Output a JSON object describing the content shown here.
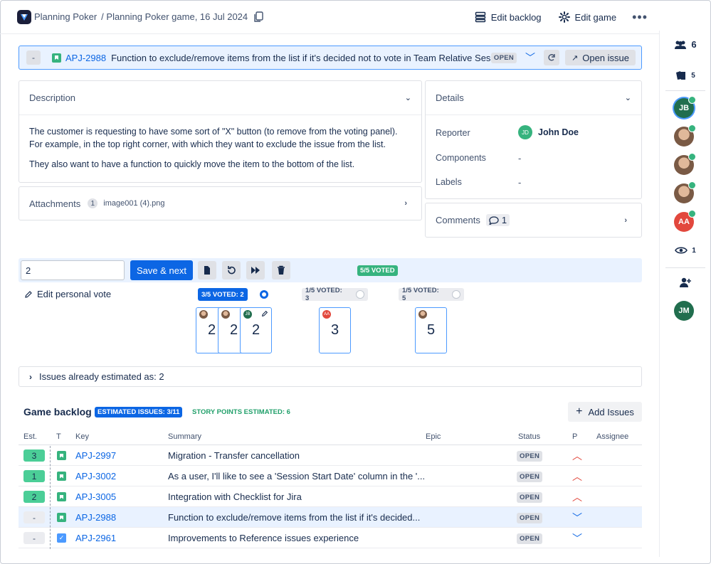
{
  "header": {
    "app_name": "Planning Poker",
    "game_name": "/ Planning Poker game, 16 Jul 2024",
    "edit_backlog": "Edit backlog",
    "edit_game": "Edit game",
    "more": "•••"
  },
  "issue_bar": {
    "dash": "-",
    "key": "APJ-2988",
    "summary": "Function to exclude/remove items from the list if it's decided not to vote in Team Relative Sessions",
    "status": "OPEN",
    "open_issue": "Open issue"
  },
  "description": {
    "title": "Description",
    "paragraph1": "The customer is requesting to have some sort of \"X\" button (to remove from the voting panel). For example, in the top right corner, with which they want to exclude the issue from the list.",
    "paragraph2": "They also want to have a function to quickly move the item to the bottom of the list."
  },
  "attachments": {
    "title": "Attachments",
    "count": "1",
    "file": "image001 (4).png"
  },
  "details": {
    "title": "Details",
    "reporter_label": "Reporter",
    "reporter_initials": "JD",
    "reporter_name": "John Doe",
    "components_label": "Components",
    "components_value": "-",
    "labels_label": "Labels",
    "labels_value": "-"
  },
  "comments": {
    "title": "Comments",
    "count": "1"
  },
  "voting": {
    "input_value": "2",
    "save_next": "Save & next",
    "voted_total": "5/5 VOTED",
    "edit_personal_vote": "Edit personal vote",
    "groups": [
      {
        "label": "3/5 VOTED: 2",
        "selected": true
      },
      {
        "label": "1/5 VOTED: 3",
        "selected": false
      },
      {
        "label": "1/5 VOTED: 5",
        "selected": false
      }
    ],
    "cards": [
      {
        "value": "2",
        "voter": "face"
      },
      {
        "value": "2",
        "voter": "face"
      },
      {
        "value": "2",
        "voter": "JB"
      },
      {
        "value": "3",
        "voter": "AA"
      },
      {
        "value": "5",
        "voter": "face"
      }
    ],
    "already_estimated": "Issues already estimated as: 2"
  },
  "rail": {
    "participants_count": "6",
    "cards_count": "5",
    "watchers_count": "1",
    "avatars": [
      "JB",
      "",
      "",
      "",
      "AA"
    ],
    "bottom_avatar": "JM"
  },
  "backlog": {
    "title": "Game backlog",
    "estimated_issues": "ESTIMATED ISSUES: 3/11",
    "story_points": "STORY POINTS ESTIMATED: 6",
    "add_issues": "Add Issues",
    "columns": {
      "est": "Est.",
      "t": "T",
      "key": "Key",
      "summary": "Summary",
      "epic": "Epic",
      "status": "Status",
      "p": "P",
      "assignee": "Assignee"
    },
    "rows": [
      {
        "est": "3",
        "type": "story",
        "key": "APJ-2997",
        "summary": "Migration - Transfer cancellation",
        "status": "OPEN",
        "priority": "high"
      },
      {
        "est": "1",
        "type": "story",
        "key": "APJ-3002",
        "summary": "As a user, I'll like to see a 'Session Start Date' column in the '...",
        "status": "OPEN",
        "priority": "high"
      },
      {
        "est": "2",
        "type": "story",
        "key": "APJ-3005",
        "summary": "Integration with Checklist for Jira",
        "status": "OPEN",
        "priority": "high"
      },
      {
        "est": "-",
        "type": "story",
        "key": "APJ-2988",
        "summary": "Function to exclude/remove items from the list if it's decided...",
        "status": "OPEN",
        "priority": "low"
      },
      {
        "est": "-",
        "type": "task",
        "key": "APJ-2961",
        "summary": "Improvements to Reference issues experience",
        "status": "OPEN",
        "priority": "low"
      }
    ]
  },
  "colors": {
    "accent": "#0c66e4",
    "success": "#36b37e",
    "priority_high": "#e2483d",
    "priority_low": "#0c66e4"
  }
}
